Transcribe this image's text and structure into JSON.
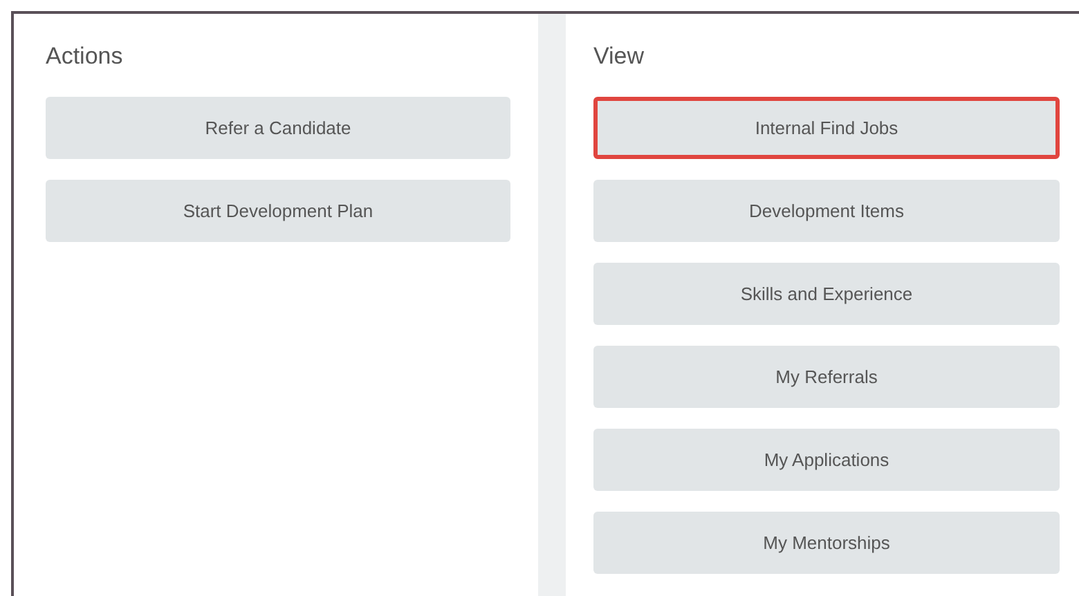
{
  "panels": [
    {
      "title": "Actions",
      "buttons": [
        {
          "label": "Refer a Candidate",
          "highlighted": false
        },
        {
          "label": "Start Development Plan",
          "highlighted": false
        }
      ]
    },
    {
      "title": "View",
      "buttons": [
        {
          "label": "Internal Find Jobs",
          "highlighted": true
        },
        {
          "label": "Development Items",
          "highlighted": false
        },
        {
          "label": "Skills and Experience",
          "highlighted": false
        },
        {
          "label": "My Referrals",
          "highlighted": false
        },
        {
          "label": "My Applications",
          "highlighted": false
        },
        {
          "label": "My Mentorships",
          "highlighted": false
        }
      ]
    }
  ]
}
